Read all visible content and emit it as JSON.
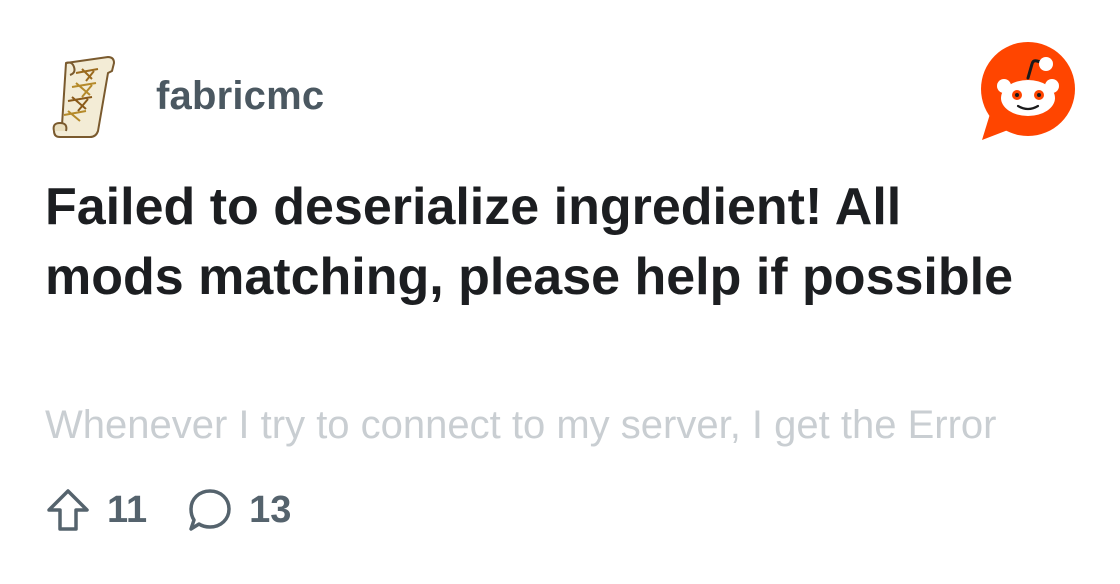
{
  "subreddit": {
    "name": "fabricmc",
    "icon": "scroll-icon"
  },
  "brand": {
    "logo": "reddit-logo-icon",
    "color": "#ff4500"
  },
  "post": {
    "title": "Failed to deserialize ingredient! All mods matching, please help if possible",
    "excerpt": "Whenever I try to connect to my server, I get the Error"
  },
  "stats": {
    "upvotes": "11",
    "comments": "13",
    "upvote_icon": "upvote-arrow-icon",
    "comment_icon": "comment-bubble-icon"
  }
}
